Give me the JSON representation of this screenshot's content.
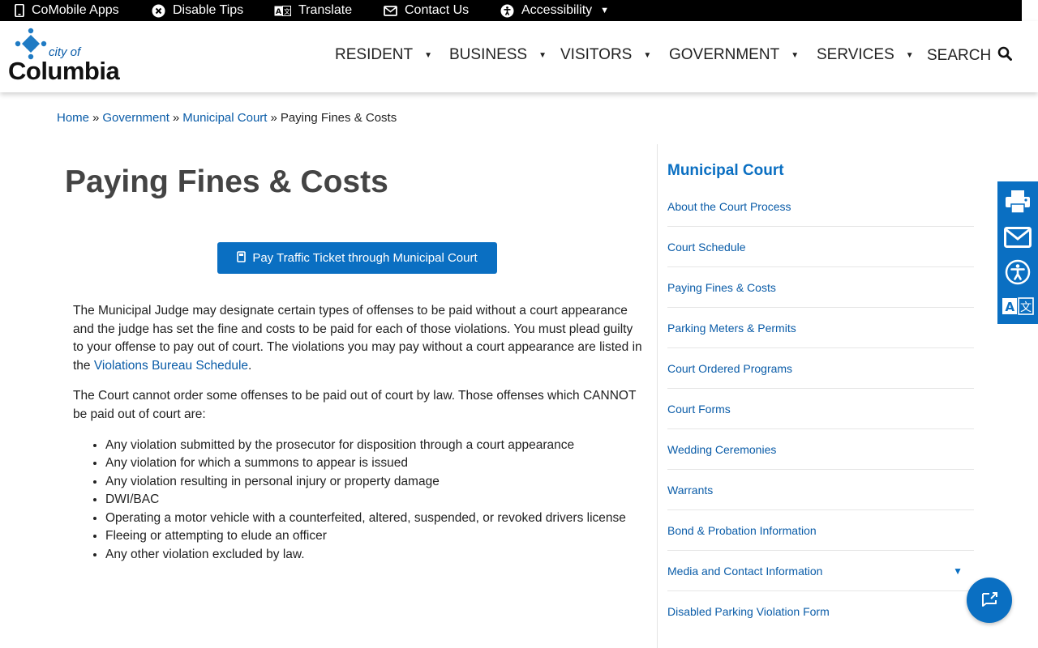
{
  "utility_bar": {
    "items": [
      {
        "label": "CoMobile Apps",
        "icon": "mobile-phone-icon"
      },
      {
        "label": "Disable Tips",
        "icon": "close-circle-icon"
      },
      {
        "label": "Translate",
        "icon": "translate-icon"
      },
      {
        "label": "Contact Us",
        "icon": "envelope-icon"
      },
      {
        "label": "Accessibility",
        "icon": "accessibility-icon"
      }
    ]
  },
  "logo": {
    "small": "city of",
    "word": "Columbia"
  },
  "nav": {
    "items": [
      "RESIDENT",
      "BUSINESS",
      "VISITORS",
      "GOVERNMENT",
      "SERVICES"
    ],
    "search": "SEARCH"
  },
  "breadcrumb": {
    "home": "Home",
    "government": "Government",
    "court": "Municipal Court",
    "current": "Paying Fines & Costs",
    "separator": "»"
  },
  "main": {
    "title": "Paying Fines & Costs",
    "pay_button": "Pay Traffic Ticket through Municipal Court",
    "p1_text": "The Municipal Judge may designate certain types of offenses to be paid without a court appearance and the judge has set the fine and costs to be paid for each of those violations. You must plead guilty to your offense to pay out of court. The violations you may pay without a court appearance are listed in the ",
    "p1_link": "Violations Bureau Schedule",
    "p1_end": ".",
    "p2": "The Court cannot order some offenses to be paid out of court by law. Those offenses which CANNOT be paid out of court are:",
    "list": [
      "Any violation submitted by the prosecutor for disposition through a court appearance",
      "Any violation for which a summons to appear is issued",
      "Any violation resulting in personal injury or property damage",
      "DWI/BAC",
      "Operating a motor vehicle with a counterfeited, altered, suspended, or revoked drivers license",
      "Fleeing or attempting to elude an officer",
      "Any other violation excluded by law."
    ]
  },
  "sidebar": {
    "title": "Municipal Court",
    "items": [
      "About the Court Process",
      "Court Schedule",
      "Paying Fines & Costs",
      "Parking Meters & Permits",
      "Court Ordered Programs",
      "Court Forms",
      "Wedding Ceremonies",
      "Warrants",
      "Bond & Probation Information",
      "Media and Contact Information",
      "Disabled Parking Violation Form"
    ]
  },
  "tools": [
    "print-icon",
    "email-icon",
    "accessibility-icon",
    "translate-icon"
  ],
  "colors": {
    "brand_blue": "#0a6fc2",
    "link_blue": "#0a5ca8",
    "utility_bar": "#000000"
  }
}
